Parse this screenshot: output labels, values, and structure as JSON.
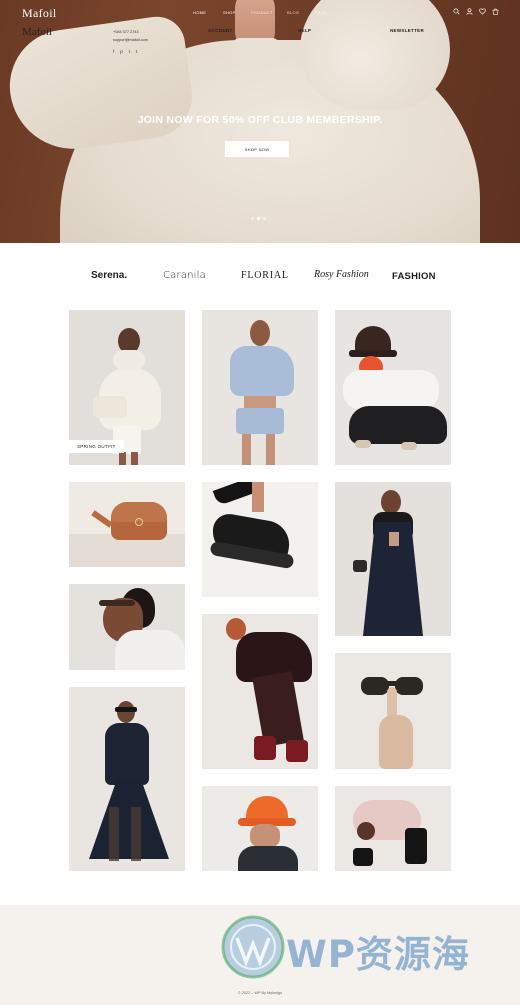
{
  "header": {
    "logo": "Mafoil",
    "menu": [
      "HOME",
      "SHOP",
      "PRODUCT",
      "BLOG",
      "PAGE"
    ],
    "icons": [
      "search-icon",
      "user-icon",
      "heart-icon",
      "cart-icon"
    ]
  },
  "hero": {
    "headline": "JOIN NOW FOR 50% OFF CLUB MEMBERSHIP.",
    "button_label": "SHOP NOW",
    "slides": 3,
    "active_slide": 1,
    "colors": {
      "background": "#6b3a24",
      "garment": "#e9e1d5"
    }
  },
  "brands": [
    "Serena.",
    "Caranila",
    "FLORIAL",
    "Rosy Fashion",
    "FASHION"
  ],
  "gallery": {
    "tag_label": "SPRING OUTFIT"
  },
  "footer": {
    "logo": "Mafoil",
    "phone": "+084 377 2743",
    "email": "support@mafoil.com",
    "social": [
      "f",
      "p",
      "t",
      "t"
    ],
    "columns": [
      {
        "title": "ACCOUNT",
        "items": []
      },
      {
        "title": "HELP",
        "items": []
      },
      {
        "title": "NEWSLETTER",
        "items": []
      }
    ],
    "copyright": "© 2022 – WP By Mylonigo"
  },
  "watermark": {
    "text": "WP资源海"
  }
}
